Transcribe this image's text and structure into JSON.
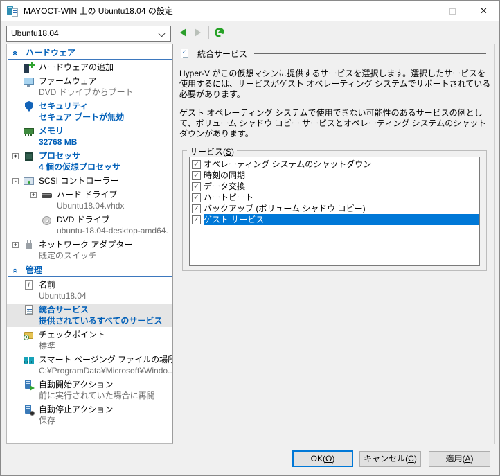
{
  "window": {
    "title": "MAYOCT-WIN 上の Ubuntu18.04 の設定",
    "minimize_glyph": "–",
    "close_glyph": "✕"
  },
  "toolbar": {
    "vm_selector_value": "Ubuntu18.04"
  },
  "sidebar": {
    "sections": [
      {
        "label": "ハードウェア",
        "items": [
          {
            "label": "ハードウェアの追加",
            "sublabel": ""
          },
          {
            "label": "ファームウェア",
            "sublabel": "DVD ドライブからブート"
          },
          {
            "label": "セキュリティ",
            "sublabel": "セキュア ブートが無効"
          },
          {
            "label": "メモリ",
            "sublabel": "32768 MB"
          },
          {
            "label": "プロセッサ",
            "sublabel": "4 個の仮想プロセッサ",
            "expander": "+"
          },
          {
            "label": "SCSI コントローラー",
            "sublabel": "",
            "expander": "-"
          },
          {
            "label": "ハード ドライブ",
            "sublabel": "Ubuntu18.04.vhdx",
            "expander": "+"
          },
          {
            "label": "DVD ドライブ",
            "sublabel": "ubuntu-18.04-desktop-amd64."
          },
          {
            "label": "ネットワーク アダプター",
            "sublabel": "既定のスイッチ",
            "expander": "+"
          }
        ]
      },
      {
        "label": "管理",
        "items": [
          {
            "label": "名前",
            "sublabel": "Ubuntu18.04"
          },
          {
            "label": "統合サービス",
            "sublabel": "提供されているすべてのサービス"
          },
          {
            "label": "チェックポイント",
            "sublabel": "標準"
          },
          {
            "label": "スマート ページング ファイルの場所",
            "sublabel": "C:¥ProgramData¥Microsoft¥Windo..."
          },
          {
            "label": "自動開始アクション",
            "sublabel": "前に実行されていた場合に再開"
          },
          {
            "label": "自動停止アクション",
            "sublabel": "保存"
          }
        ]
      }
    ]
  },
  "main": {
    "header_label": "統合サービス",
    "paragraph1": "Hyper-V がこの仮想マシンに提供するサービスを選択します。選択したサービスを使用するには、サービスがゲスト オペレーティング システムでサポートされている必要があります。",
    "paragraph2": "ゲスト オペレーティング システムで使用できない可能性のあるサービスの例として、ボリューム シャドウ コピー サービスとオペレーティング システムのシャットダウンがあります。",
    "services_label": {
      "pre": "サービス(",
      "key": "S",
      "suf": ")"
    },
    "services": [
      {
        "label": "オペレーティング システムのシャットダウン",
        "check": "✓",
        "checked": true,
        "selected": false
      },
      {
        "label": "時刻の同期",
        "check": "✓",
        "checked": true,
        "selected": false
      },
      {
        "label": "データ交換",
        "check": "✓",
        "checked": true,
        "selected": false
      },
      {
        "label": "ハートビート",
        "check": "✓",
        "checked": true,
        "selected": false
      },
      {
        "label": "バックアップ (ボリューム シャドウ コピー)",
        "check": "✓",
        "checked": true,
        "selected": false
      },
      {
        "label": "ゲスト サービス",
        "check": "✓",
        "checked": true,
        "selected": true
      }
    ]
  },
  "footer": {
    "ok": {
      "pre": "OK(",
      "key": "O",
      "suf": ")"
    },
    "cancel": {
      "pre": "キャンセル(",
      "key": "C",
      "suf": ")"
    },
    "apply": {
      "pre": "適用(",
      "key": "A",
      "suf": ")"
    }
  },
  "colors": {
    "accent": "#0078d7",
    "sidebar_link_blue": "#005fb8",
    "selection_background": "#0078d7",
    "muted_text": "#6e6e6e"
  }
}
